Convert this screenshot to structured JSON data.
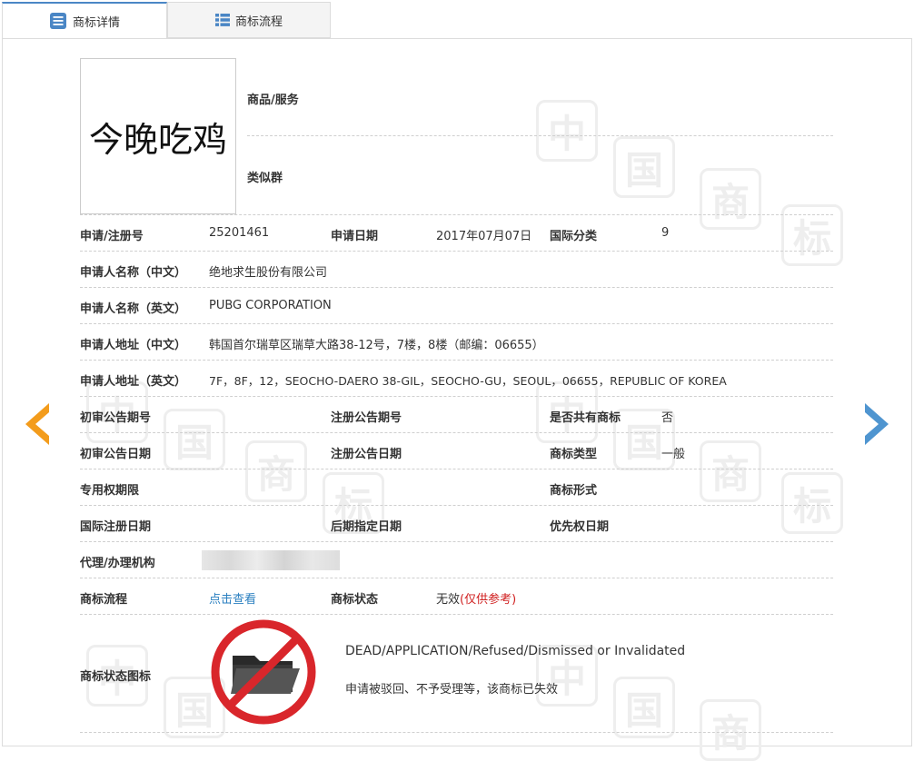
{
  "tabs": [
    {
      "label": "商标详情",
      "icon": "document-list-icon",
      "active": true
    },
    {
      "label": "商标流程",
      "icon": "grid-list-icon",
      "active": false
    }
  ],
  "watermark_chars": [
    "中",
    "国",
    "商",
    "标"
  ],
  "trademark": {
    "image_text": "今晚吃鸡",
    "goods_services_label": "商品/服务",
    "similar_group_label": "类似群"
  },
  "fields": {
    "reg_no": {
      "label": "申请/注册号",
      "value": "25201461"
    },
    "app_date": {
      "label": "申请日期",
      "value": "2017年07月07日"
    },
    "intl_class": {
      "label": "国际分类",
      "value": "9"
    },
    "applicant_cn": {
      "label": "申请人名称（中文）",
      "value": "绝地求生股份有限公司"
    },
    "applicant_en": {
      "label": "申请人名称（英文）",
      "value": "PUBG CORPORATION"
    },
    "address_cn": {
      "label": "申请人地址（中文）",
      "value": "韩国首尔瑞草区瑞草大路38-12号，7楼，8楼（邮编：06655）"
    },
    "address_en": {
      "label": "申请人地址（英文）",
      "value": "7F，8F，12，SEOCHO-DAERO 38-GIL，SEOCHO-GU，SEOUL，06655，REPUBLIC OF KOREA"
    },
    "prelim_pub_no": {
      "label": "初审公告期号",
      "value": ""
    },
    "reg_pub_no": {
      "label": "注册公告期号",
      "value": ""
    },
    "shared": {
      "label": "是否共有商标",
      "value": "否"
    },
    "prelim_pub_date": {
      "label": "初审公告日期",
      "value": ""
    },
    "reg_pub_date": {
      "label": "注册公告日期",
      "value": ""
    },
    "mark_type": {
      "label": "商标类型",
      "value": "一般"
    },
    "exclusive_period": {
      "label": "专用权期限",
      "value": ""
    },
    "mark_form": {
      "label": "商标形式",
      "value": ""
    },
    "intl_reg_date": {
      "label": "国际注册日期",
      "value": ""
    },
    "later_designation": {
      "label": "后期指定日期",
      "value": ""
    },
    "priority_date": {
      "label": "优先权日期",
      "value": ""
    },
    "agent": {
      "label": "代理/办理机构",
      "value": ""
    },
    "process": {
      "label": "商标流程",
      "link": "点击查看"
    },
    "status": {
      "label": "商标状态",
      "value": "无效",
      "note": "(仅供参考)"
    }
  },
  "status_icon": {
    "label": "商标状态图标",
    "icon": "prohibited-folder-icon",
    "en_text": "DEAD/APPLICATION/Refused/Dismissed or Invalidated",
    "cn_text": "申请被驳回、不予受理等，该商标已失效"
  },
  "colors": {
    "prev_arrow": "#f39c1c",
    "next_arrow": "#4f95d0",
    "tab_accent": "#4a86c5",
    "link": "#2a7fc0",
    "status_note": "#d02020",
    "no_sign": "#d9262b"
  }
}
